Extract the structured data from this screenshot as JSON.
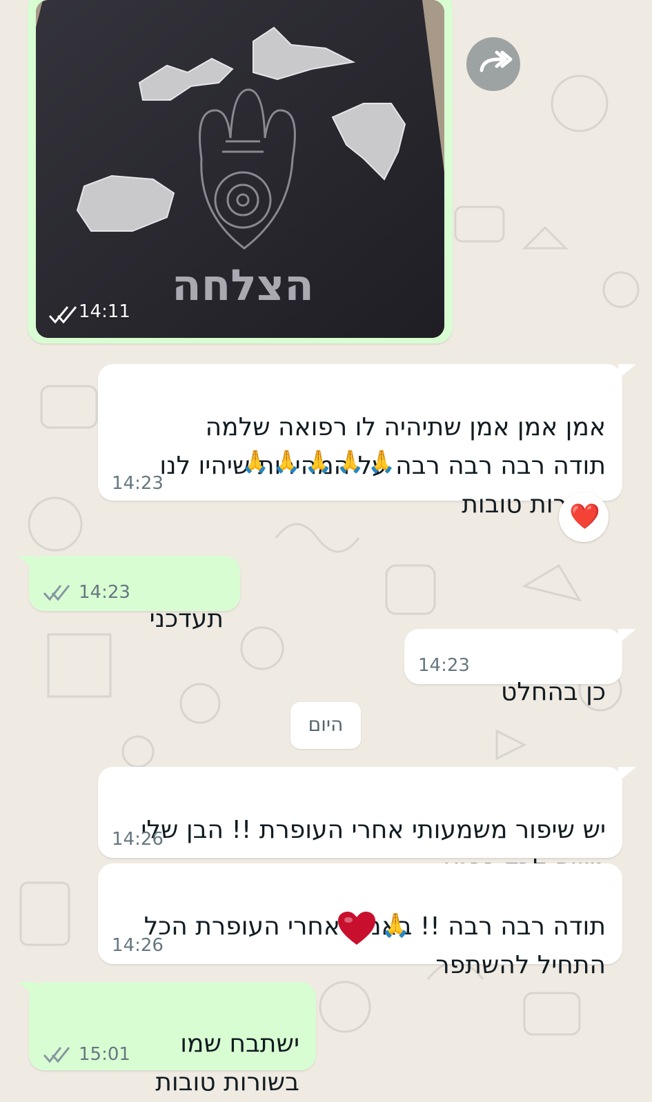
{
  "chat": {
    "photo_message": {
      "time": "14:11",
      "towel_text": "הצלחה",
      "status": "read"
    },
    "forward_button": {
      "icon": "forward-icon"
    },
    "messages": [
      {
        "id": "m1",
        "direction": "in",
        "text": "אמן אמן אמן שתיהיה לו רפואה שלמה\nתודה רבה רבה רבה על המהירות שיהיו לנו\nבשורות טובות",
        "emoji": "🙏🙏🙏🙏🙏",
        "time": "14:23",
        "reaction": "❤️"
      },
      {
        "id": "m2",
        "direction": "out",
        "text": "תעדכני",
        "time": "14:23",
        "status": "read"
      },
      {
        "id": "m3",
        "direction": "in",
        "text": "כן בהחלט",
        "time": "14:23"
      },
      {
        "id": "m4",
        "direction": "in",
        "text": "יש שיפור משמעותי אחרי העופרת !! הבן שלי\nנושם לבד כרגע",
        "time": "14:26"
      },
      {
        "id": "m5",
        "direction": "in",
        "text": "תודה רבה רבה !! באמת אחרי העופרת הכל\nהתחיל להשתפר",
        "emoji": "🙏",
        "time": "14:26"
      },
      {
        "id": "m6",
        "direction": "out",
        "text": "ישתבח שמו\nבשורות טובות",
        "time": "15:01",
        "status": "read"
      }
    ],
    "date_separator": "היום"
  },
  "colors": {
    "background": "#efeae2",
    "incoming_bubble": "#ffffff",
    "outgoing_bubble": "#d9fdd3",
    "text": "#111b21",
    "timestamp": "#667781",
    "read_ticks": "#8696a0"
  }
}
